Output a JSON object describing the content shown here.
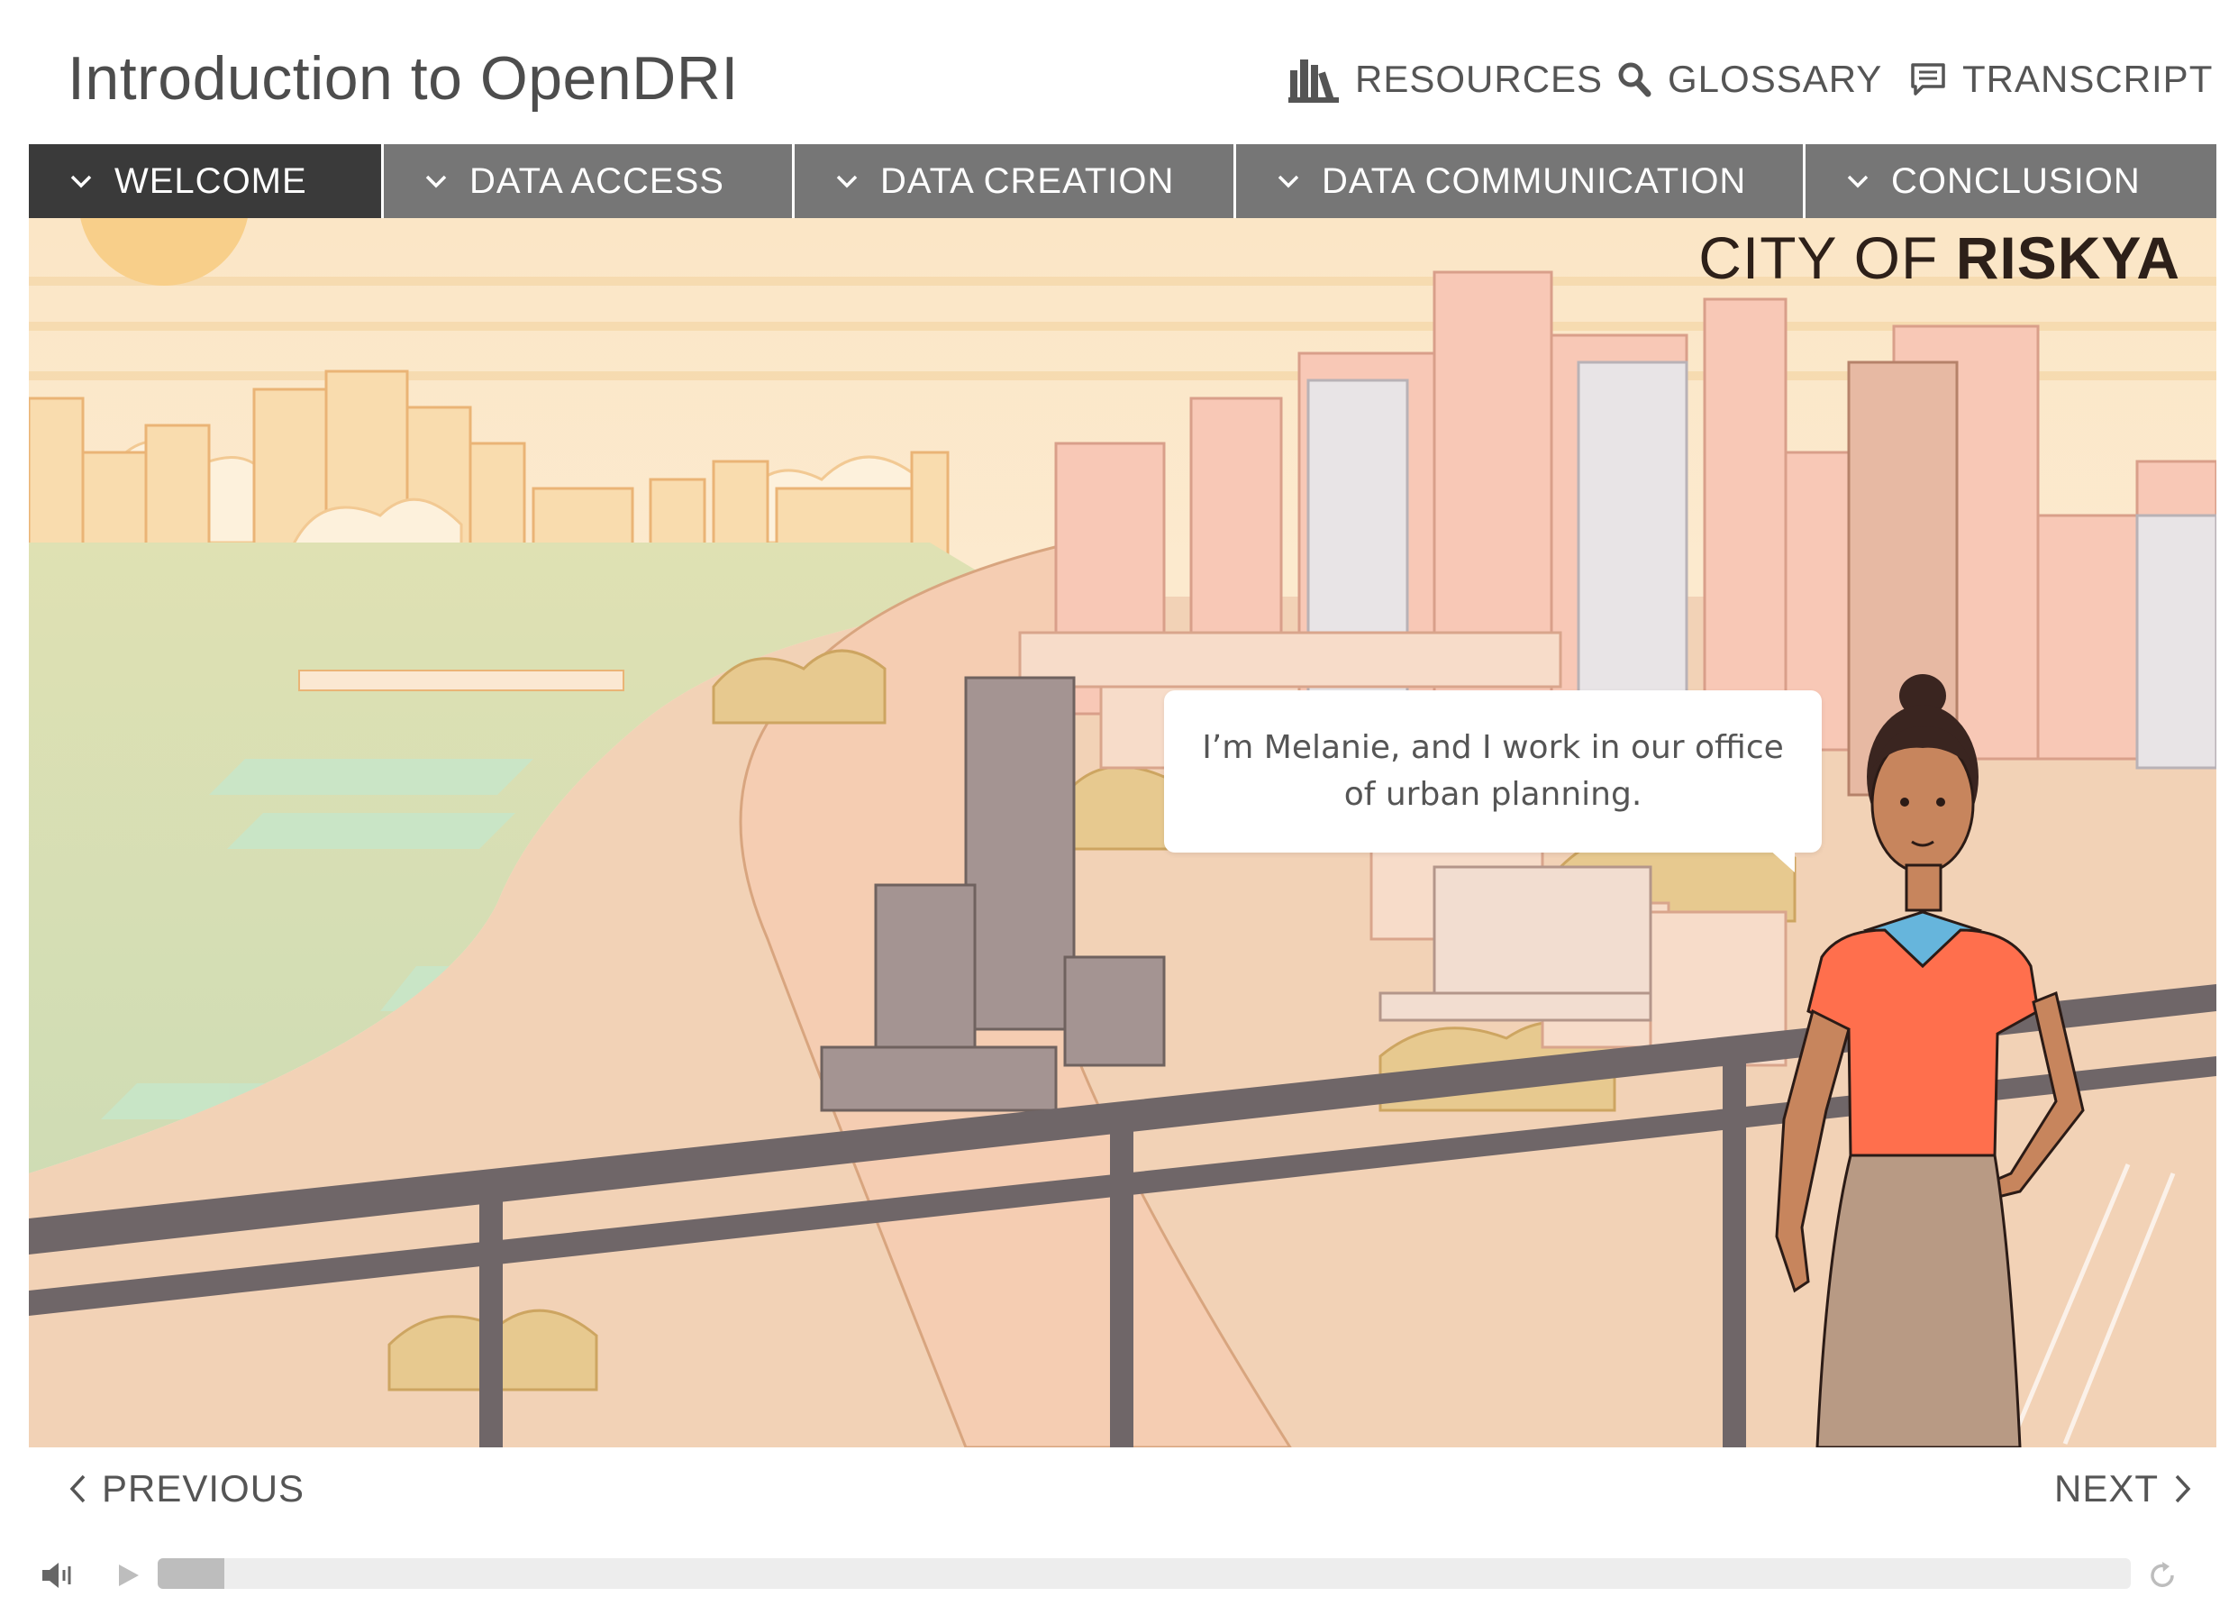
{
  "header": {
    "title": "Introduction to OpenDRI",
    "resources_label": "RESOURCES",
    "glossary_label": "GLOSSARY",
    "transcript_label": "TRANSCRIPT"
  },
  "nav": {
    "tabs": [
      {
        "label": "WELCOME",
        "active": true
      },
      {
        "label": "DATA ACCESS",
        "active": false
      },
      {
        "label": "DATA CREATION",
        "active": false
      },
      {
        "label": "DATA COMMUNICATION",
        "active": false
      },
      {
        "label": "CONCLUSION",
        "active": false
      }
    ]
  },
  "scene": {
    "city_prefix": "CITY OF ",
    "city_name": "RISKYA",
    "speech": "I’m Melanie, and I work in our office of urban planning."
  },
  "pager": {
    "previous_label": "PREVIOUS",
    "next_label": "NEXT"
  },
  "player": {
    "progress_percent": 3.4
  },
  "icons": {
    "resources": "books-icon",
    "glossary": "search-icon",
    "transcript": "chat-icon",
    "previous": "chevron-left-icon",
    "next": "chevron-right-icon",
    "volume": "volume-icon",
    "play": "play-icon",
    "replay": "replay-icon"
  },
  "colors": {
    "active_tab": "#3a3a3a",
    "tab": "#767676",
    "shirt": "#ff6f4d",
    "skirt": "#b89a84"
  }
}
